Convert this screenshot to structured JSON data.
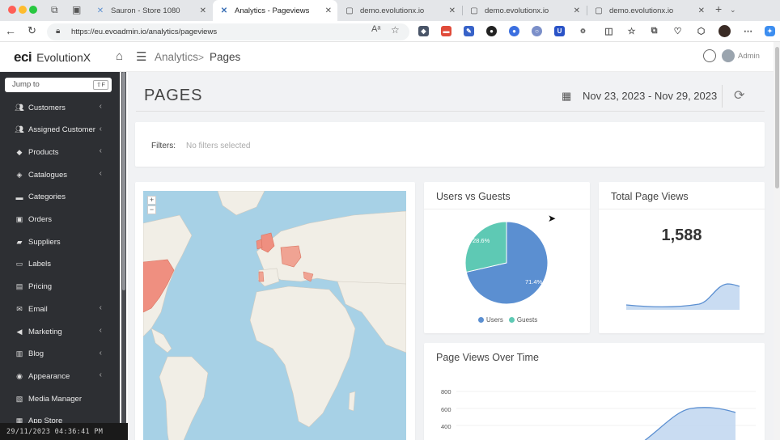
{
  "browser": {
    "tabs": [
      {
        "title": "Sauron - Store 1080",
        "active": false
      },
      {
        "title": "Analytics - Pageviews",
        "active": true
      },
      {
        "title": "demo.evolutionx.io",
        "active": false
      },
      {
        "title": "demo.evolutionx.io",
        "active": false
      },
      {
        "title": "demo.evolutionx.io",
        "active": false
      }
    ],
    "url": "https://eu.evoadmin.io/analytics/pageviews",
    "read_aloud_icon": "Aᵃ"
  },
  "header": {
    "logo_mark": "eci",
    "logo_name": "EvolutionX",
    "breadcrumb": [
      "Analytics",
      "Pages"
    ],
    "breadcrumb_sep": ">",
    "user_label": "Admin"
  },
  "sidebar": {
    "jump_placeholder": "Jump to",
    "jump_shortcut": "⇧F",
    "items": [
      {
        "label": "Customers",
        "icon": "users-icon",
        "chevron": true
      },
      {
        "label": "Assigned Customer",
        "icon": "users-icon",
        "chevron": true
      },
      {
        "label": "Products",
        "icon": "tag-icon",
        "chevron": true
      },
      {
        "label": "Catalogues",
        "icon": "tags-icon",
        "chevron": true
      },
      {
        "label": "Categories",
        "icon": "folder-icon",
        "chevron": false
      },
      {
        "label": "Orders",
        "icon": "box-icon",
        "chevron": false
      },
      {
        "label": "Suppliers",
        "icon": "truck-icon",
        "chevron": false
      },
      {
        "label": "Labels",
        "icon": "label-icon",
        "chevron": false
      },
      {
        "label": "Pricing",
        "icon": "price-icon",
        "chevron": false
      },
      {
        "label": "Email",
        "icon": "envelope-icon",
        "chevron": true
      },
      {
        "label": "Marketing",
        "icon": "megaphone-icon",
        "chevron": true
      },
      {
        "label": "Blog",
        "icon": "blog-icon",
        "chevron": true
      },
      {
        "label": "Appearance",
        "icon": "palette-icon",
        "chevron": true
      },
      {
        "label": "Media Manager",
        "icon": "image-icon",
        "chevron": false
      },
      {
        "label": "App Store",
        "icon": "store-icon",
        "chevron": false
      }
    ]
  },
  "timestamp": "29/11/2023 04:36:41 PM",
  "page": {
    "title": "PAGES",
    "date_range": "Nov 23, 2023 - Nov 29, 2023",
    "filters_label": "Filters:",
    "filters_value": "No filters selected"
  },
  "users_vs_guests": {
    "title": "Users vs Guests",
    "slices": [
      {
        "name": "Users",
        "value": 71.4,
        "label": "71.4%",
        "color": "#5b8fd1"
      },
      {
        "name": "Guests",
        "value": 28.6,
        "label": "28.6%",
        "color": "#5ec9b4"
      }
    ]
  },
  "total_page_views": {
    "title": "Total Page Views",
    "value": "1,588",
    "sparkline_color": "#5b8fd1"
  },
  "page_views_over_time": {
    "title": "Page Views Over Time",
    "y_ticks": [
      "800",
      "600",
      "400"
    ],
    "color": "#5b8fd1"
  },
  "colors": {
    "sidebar_bg": "#2d2f33",
    "accent_blue": "#5b8fd1",
    "accent_teal": "#5ec9b4",
    "map_water": "#a7d1e6",
    "map_land": "#f1eee6",
    "map_highlight": "#ef8f80"
  }
}
